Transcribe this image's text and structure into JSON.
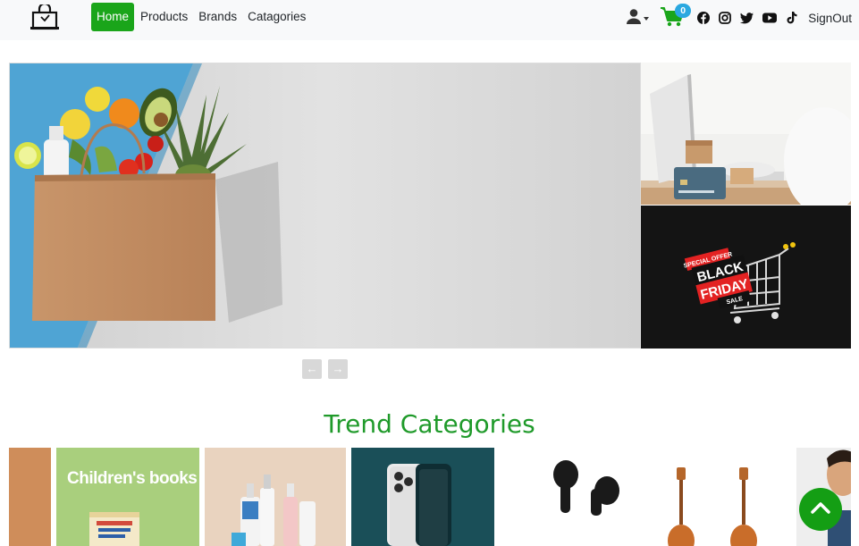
{
  "nav": {
    "links": [
      {
        "label": "Home"
      },
      {
        "label": "Products"
      },
      {
        "label": "Brands"
      },
      {
        "label": "Catagories"
      }
    ],
    "cart_count": "0",
    "signout_label": "SignOut",
    "social_icons": [
      "facebook-icon",
      "instagram-icon",
      "twitter-icon",
      "youtube-icon",
      "tiktok-icon"
    ],
    "accent_color": "#1aa51a",
    "cart_color": "#1aa51a",
    "badge_color": "#2aa8e0"
  },
  "carousel": {
    "prev_label": "←",
    "next_label": "→"
  },
  "promo": {
    "badge_top": "SPECIAL OFFER",
    "line1": "BLACK",
    "line2": "FRIDAY",
    "badge_bottom": "SALE"
  },
  "trend": {
    "title": "Trend Categories",
    "title_color": "#1f9a2a",
    "categories": [
      {
        "label": ""
      },
      {
        "label": "Children's books"
      },
      {
        "label": ""
      },
      {
        "label": ""
      },
      {
        "label": ""
      },
      {
        "label": ""
      },
      {
        "label": ""
      }
    ]
  }
}
